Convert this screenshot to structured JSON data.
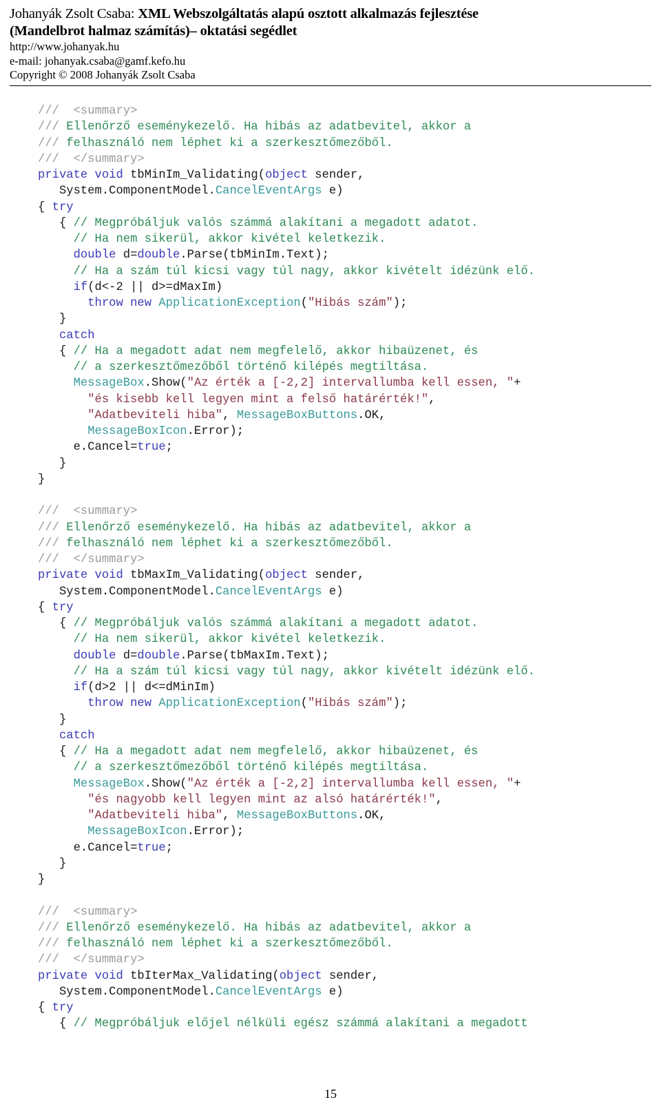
{
  "header": {
    "author_prefix": "Johanyák Zsolt Csaba: ",
    "title_line1": "XML Webszolgáltatás alapú osztott alkalmazás fejlesztése",
    "title_line2": "(Mandelbrot halmaz számítás)– oktatási segédlet",
    "website": "http://www.johanyak.hu",
    "email": "e-mail: johanyak.csaba@gamf.kefo.hu",
    "copyright": "Copyright © 2008 Johanyák Zsolt Csaba"
  },
  "footer": {
    "page_number": "15"
  },
  "colors": {
    "doc_comment": "#9b9b9b",
    "comment": "#2e8b57",
    "keyword": "#3c3cb4",
    "type": "#3a9a9a",
    "string": "#8b3a4a",
    "plain": "#1a1a1a"
  },
  "code": {
    "language": "csharp",
    "lines": [
      [
        {
          "t": "doc",
          "s": "///  "
        },
        {
          "t": "doc",
          "s": "<summary>"
        }
      ],
      [
        {
          "t": "doc",
          "s": "/// "
        },
        {
          "t": "cmt",
          "s": "Ellenőrző eseménykezelő. Ha hibás az adatbevitel, akkor a"
        }
      ],
      [
        {
          "t": "doc",
          "s": "/// "
        },
        {
          "t": "cmt",
          "s": "felhasználó nem léphet ki a szerkesztőmezőből."
        }
      ],
      [
        {
          "t": "doc",
          "s": "///  "
        },
        {
          "t": "doc",
          "s": "</summary>"
        }
      ],
      [
        {
          "t": "kw",
          "s": "private void"
        },
        {
          "t": "plain",
          "s": " tbMinIm_Validating("
        },
        {
          "t": "kw",
          "s": "object"
        },
        {
          "t": "plain",
          "s": " sender,"
        }
      ],
      [
        {
          "t": "plain",
          "s": "   System.ComponentModel."
        },
        {
          "t": "type",
          "s": "CancelEventArgs"
        },
        {
          "t": "plain",
          "s": " e)"
        }
      ],
      [
        {
          "t": "plain",
          "s": "{ "
        },
        {
          "t": "kw",
          "s": "try"
        }
      ],
      [
        {
          "t": "plain",
          "s": "   { "
        },
        {
          "t": "cmt",
          "s": "// Megpróbáljuk valós számmá alakítani a megadott adatot."
        }
      ],
      [
        {
          "t": "plain",
          "s": "     "
        },
        {
          "t": "cmt",
          "s": "// Ha nem sikerül, akkor kivétel keletkezik."
        }
      ],
      [
        {
          "t": "plain",
          "s": "     "
        },
        {
          "t": "kw",
          "s": "double"
        },
        {
          "t": "plain",
          "s": " d="
        },
        {
          "t": "kw",
          "s": "double"
        },
        {
          "t": "plain",
          "s": ".Parse(tbMinIm.Text);"
        }
      ],
      [
        {
          "t": "plain",
          "s": "     "
        },
        {
          "t": "cmt",
          "s": "// Ha a szám túl kicsi vagy túl nagy, akkor kivételt idézünk elő."
        }
      ],
      [
        {
          "t": "plain",
          "s": "     "
        },
        {
          "t": "kw",
          "s": "if"
        },
        {
          "t": "plain",
          "s": "(d<-2 || d>=dMaxIm)"
        }
      ],
      [
        {
          "t": "plain",
          "s": "       "
        },
        {
          "t": "kw",
          "s": "throw new"
        },
        {
          "t": "plain",
          "s": " "
        },
        {
          "t": "type",
          "s": "ApplicationException"
        },
        {
          "t": "plain",
          "s": "("
        },
        {
          "t": "str",
          "s": "\"Hibás szám\""
        },
        {
          "t": "plain",
          "s": ");"
        }
      ],
      [
        {
          "t": "plain",
          "s": "   }"
        }
      ],
      [
        {
          "t": "plain",
          "s": "   "
        },
        {
          "t": "kw",
          "s": "catch"
        }
      ],
      [
        {
          "t": "plain",
          "s": "   { "
        },
        {
          "t": "cmt",
          "s": "// Ha a megadott adat nem megfelelő, akkor hibaüzenet, és"
        }
      ],
      [
        {
          "t": "plain",
          "s": "     "
        },
        {
          "t": "cmt",
          "s": "// a szerkesztőmezőből történő kilépés megtiltása."
        }
      ],
      [
        {
          "t": "plain",
          "s": "     "
        },
        {
          "t": "type",
          "s": "MessageBox"
        },
        {
          "t": "plain",
          "s": ".Show("
        },
        {
          "t": "str",
          "s": "\"Az érték a [-2,2] intervallumba kell essen, \""
        },
        {
          "t": "plain",
          "s": "+"
        }
      ],
      [
        {
          "t": "plain",
          "s": "       "
        },
        {
          "t": "str",
          "s": "\"és kisebb kell legyen mint a felső határérték!\""
        },
        {
          "t": "plain",
          "s": ","
        }
      ],
      [
        {
          "t": "plain",
          "s": "       "
        },
        {
          "t": "str",
          "s": "\"Adatbeviteli hiba\""
        },
        {
          "t": "plain",
          "s": ", "
        },
        {
          "t": "type",
          "s": "MessageBoxButtons"
        },
        {
          "t": "plain",
          "s": ".OK,"
        }
      ],
      [
        {
          "t": "plain",
          "s": "       "
        },
        {
          "t": "type",
          "s": "MessageBoxIcon"
        },
        {
          "t": "plain",
          "s": ".Error);"
        }
      ],
      [
        {
          "t": "plain",
          "s": "     e.Cancel="
        },
        {
          "t": "kw",
          "s": "true"
        },
        {
          "t": "plain",
          "s": ";"
        }
      ],
      [
        {
          "t": "plain",
          "s": "   }"
        }
      ],
      [
        {
          "t": "plain",
          "s": "}"
        }
      ],
      [],
      [
        {
          "t": "doc",
          "s": "///  "
        },
        {
          "t": "doc",
          "s": "<summary>"
        }
      ],
      [
        {
          "t": "doc",
          "s": "/// "
        },
        {
          "t": "cmt",
          "s": "Ellenőrző eseménykezelő. Ha hibás az adatbevitel, akkor a"
        }
      ],
      [
        {
          "t": "doc",
          "s": "/// "
        },
        {
          "t": "cmt",
          "s": "felhasználó nem léphet ki a szerkesztőmezőből."
        }
      ],
      [
        {
          "t": "doc",
          "s": "///  "
        },
        {
          "t": "doc",
          "s": "</summary>"
        }
      ],
      [
        {
          "t": "kw",
          "s": "private void"
        },
        {
          "t": "plain",
          "s": " tbMaxIm_Validating("
        },
        {
          "t": "kw",
          "s": "object"
        },
        {
          "t": "plain",
          "s": " sender,"
        }
      ],
      [
        {
          "t": "plain",
          "s": "   System.ComponentModel."
        },
        {
          "t": "type",
          "s": "CancelEventArgs"
        },
        {
          "t": "plain",
          "s": " e)"
        }
      ],
      [
        {
          "t": "plain",
          "s": "{ "
        },
        {
          "t": "kw",
          "s": "try"
        }
      ],
      [
        {
          "t": "plain",
          "s": "   { "
        },
        {
          "t": "cmt",
          "s": "// Megpróbáljuk valós számmá alakítani a megadott adatot."
        }
      ],
      [
        {
          "t": "plain",
          "s": "     "
        },
        {
          "t": "cmt",
          "s": "// Ha nem sikerül, akkor kivétel keletkezik."
        }
      ],
      [
        {
          "t": "plain",
          "s": "     "
        },
        {
          "t": "kw",
          "s": "double"
        },
        {
          "t": "plain",
          "s": " d="
        },
        {
          "t": "kw",
          "s": "double"
        },
        {
          "t": "plain",
          "s": ".Parse(tbMaxIm.Text);"
        }
      ],
      [
        {
          "t": "plain",
          "s": "     "
        },
        {
          "t": "cmt",
          "s": "// Ha a szám túl kicsi vagy túl nagy, akkor kivételt idézünk elő."
        }
      ],
      [
        {
          "t": "plain",
          "s": "     "
        },
        {
          "t": "kw",
          "s": "if"
        },
        {
          "t": "plain",
          "s": "(d>2 || d<=dMinIm)"
        }
      ],
      [
        {
          "t": "plain",
          "s": "       "
        },
        {
          "t": "kw",
          "s": "throw new"
        },
        {
          "t": "plain",
          "s": " "
        },
        {
          "t": "type",
          "s": "ApplicationException"
        },
        {
          "t": "plain",
          "s": "("
        },
        {
          "t": "str",
          "s": "\"Hibás szám\""
        },
        {
          "t": "plain",
          "s": ");"
        }
      ],
      [
        {
          "t": "plain",
          "s": "   }"
        }
      ],
      [
        {
          "t": "plain",
          "s": "   "
        },
        {
          "t": "kw",
          "s": "catch"
        }
      ],
      [
        {
          "t": "plain",
          "s": "   { "
        },
        {
          "t": "cmt",
          "s": "// Ha a megadott adat nem megfelelő, akkor hibaüzenet, és"
        }
      ],
      [
        {
          "t": "plain",
          "s": "     "
        },
        {
          "t": "cmt",
          "s": "// a szerkesztőmezőből történő kilépés megtiltása."
        }
      ],
      [
        {
          "t": "plain",
          "s": "     "
        },
        {
          "t": "type",
          "s": "MessageBox"
        },
        {
          "t": "plain",
          "s": ".Show("
        },
        {
          "t": "str",
          "s": "\"Az érték a [-2,2] intervallumba kell essen, \""
        },
        {
          "t": "plain",
          "s": "+"
        }
      ],
      [
        {
          "t": "plain",
          "s": "       "
        },
        {
          "t": "str",
          "s": "\"és nagyobb kell legyen mint az alsó határérték!\""
        },
        {
          "t": "plain",
          "s": ","
        }
      ],
      [
        {
          "t": "plain",
          "s": "       "
        },
        {
          "t": "str",
          "s": "\"Adatbeviteli hiba\""
        },
        {
          "t": "plain",
          "s": ", "
        },
        {
          "t": "type",
          "s": "MessageBoxButtons"
        },
        {
          "t": "plain",
          "s": ".OK,"
        }
      ],
      [
        {
          "t": "plain",
          "s": "       "
        },
        {
          "t": "type",
          "s": "MessageBoxIcon"
        },
        {
          "t": "plain",
          "s": ".Error);"
        }
      ],
      [
        {
          "t": "plain",
          "s": "     e.Cancel="
        },
        {
          "t": "kw",
          "s": "true"
        },
        {
          "t": "plain",
          "s": ";"
        }
      ],
      [
        {
          "t": "plain",
          "s": "   }"
        }
      ],
      [
        {
          "t": "plain",
          "s": "}"
        }
      ],
      [],
      [
        {
          "t": "doc",
          "s": "///  "
        },
        {
          "t": "doc",
          "s": "<summary>"
        }
      ],
      [
        {
          "t": "doc",
          "s": "/// "
        },
        {
          "t": "cmt",
          "s": "Ellenőrző eseménykezelő. Ha hibás az adatbevitel, akkor a"
        }
      ],
      [
        {
          "t": "doc",
          "s": "/// "
        },
        {
          "t": "cmt",
          "s": "felhasználó nem léphet ki a szerkesztőmezőből."
        }
      ],
      [
        {
          "t": "doc",
          "s": "///  "
        },
        {
          "t": "doc",
          "s": "</summary>"
        }
      ],
      [
        {
          "t": "kw",
          "s": "private void"
        },
        {
          "t": "plain",
          "s": " tbIterMax_Validating("
        },
        {
          "t": "kw",
          "s": "object"
        },
        {
          "t": "plain",
          "s": " sender,"
        }
      ],
      [
        {
          "t": "plain",
          "s": "   System.ComponentModel."
        },
        {
          "t": "type",
          "s": "CancelEventArgs"
        },
        {
          "t": "plain",
          "s": " e)"
        }
      ],
      [
        {
          "t": "plain",
          "s": "{ "
        },
        {
          "t": "kw",
          "s": "try"
        }
      ],
      [
        {
          "t": "plain",
          "s": "   { "
        },
        {
          "t": "cmt",
          "s": "// Megpróbáljuk előjel nélküli egész számmá alakítani a megadott"
        }
      ]
    ]
  }
}
